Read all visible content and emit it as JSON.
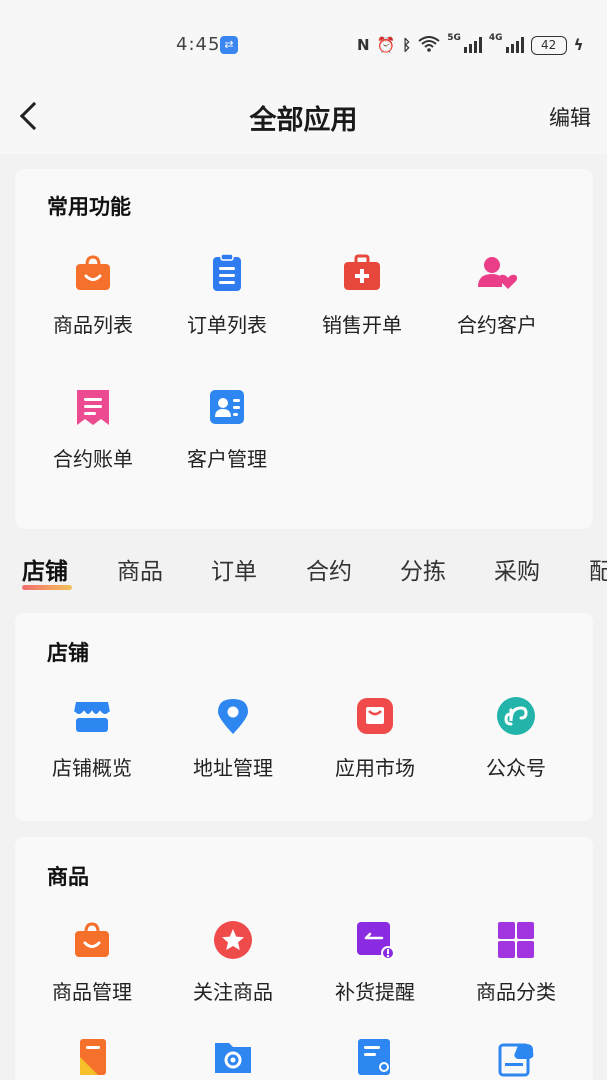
{
  "status": {
    "time": "4:45",
    "network_5g": "5G",
    "network_4g": "4G",
    "battery": "42"
  },
  "nav": {
    "title": "全部应用",
    "edit": "编辑"
  },
  "favorites": {
    "title": "常用功能",
    "items": [
      {
        "label": "商品列表",
        "icon": "shopping-bag-icon",
        "color": "#f5702a"
      },
      {
        "label": "订单列表",
        "icon": "clipboard-icon",
        "color": "#2f7cf0"
      },
      {
        "label": "销售开单",
        "icon": "medical-kit-icon",
        "color": "#e8483c"
      },
      {
        "label": "合约客户",
        "icon": "person-heart-icon",
        "color": "#ea3f88"
      },
      {
        "label": "合约账单",
        "icon": "bill-icon",
        "color": "#ec4a91"
      },
      {
        "label": "客户管理",
        "icon": "contact-card-icon",
        "color": "#2e86f0"
      }
    ]
  },
  "tabs": [
    "店铺",
    "商品",
    "订单",
    "合约",
    "分拣",
    "采购",
    "配"
  ],
  "store": {
    "title": "店铺",
    "items": [
      {
        "label": "店铺概览",
        "icon": "storefront-icon",
        "color": "#2e86f0"
      },
      {
        "label": "地址管理",
        "icon": "location-pin-icon",
        "color": "#2e86f0"
      },
      {
        "label": "应用市场",
        "icon": "app-market-icon",
        "color": "#ef4b4b"
      },
      {
        "label": "公众号",
        "icon": "link-circle-icon",
        "color": "#22b3a9"
      }
    ]
  },
  "goods": {
    "title": "商品",
    "items": [
      {
        "label": "商品管理",
        "icon": "shopping-bag-icon",
        "color": "#f5702a"
      },
      {
        "label": "关注商品",
        "icon": "star-circle-icon",
        "color": "#ef4b4b"
      },
      {
        "label": "补货提醒",
        "icon": "restock-alert-icon",
        "color": "#8a2be2"
      },
      {
        "label": "商品分类",
        "icon": "category-grid-icon",
        "color": "#a235e0"
      }
    ],
    "more_icons": [
      {
        "icon": "bookmark-icon",
        "color": "#f5702a"
      },
      {
        "icon": "settings-folder-icon",
        "color": "#2e86f0"
      },
      {
        "icon": "document-search-icon",
        "color": "#2e86f0"
      },
      {
        "icon": "cloud-image-icon",
        "color": "#2e86f0"
      }
    ]
  }
}
